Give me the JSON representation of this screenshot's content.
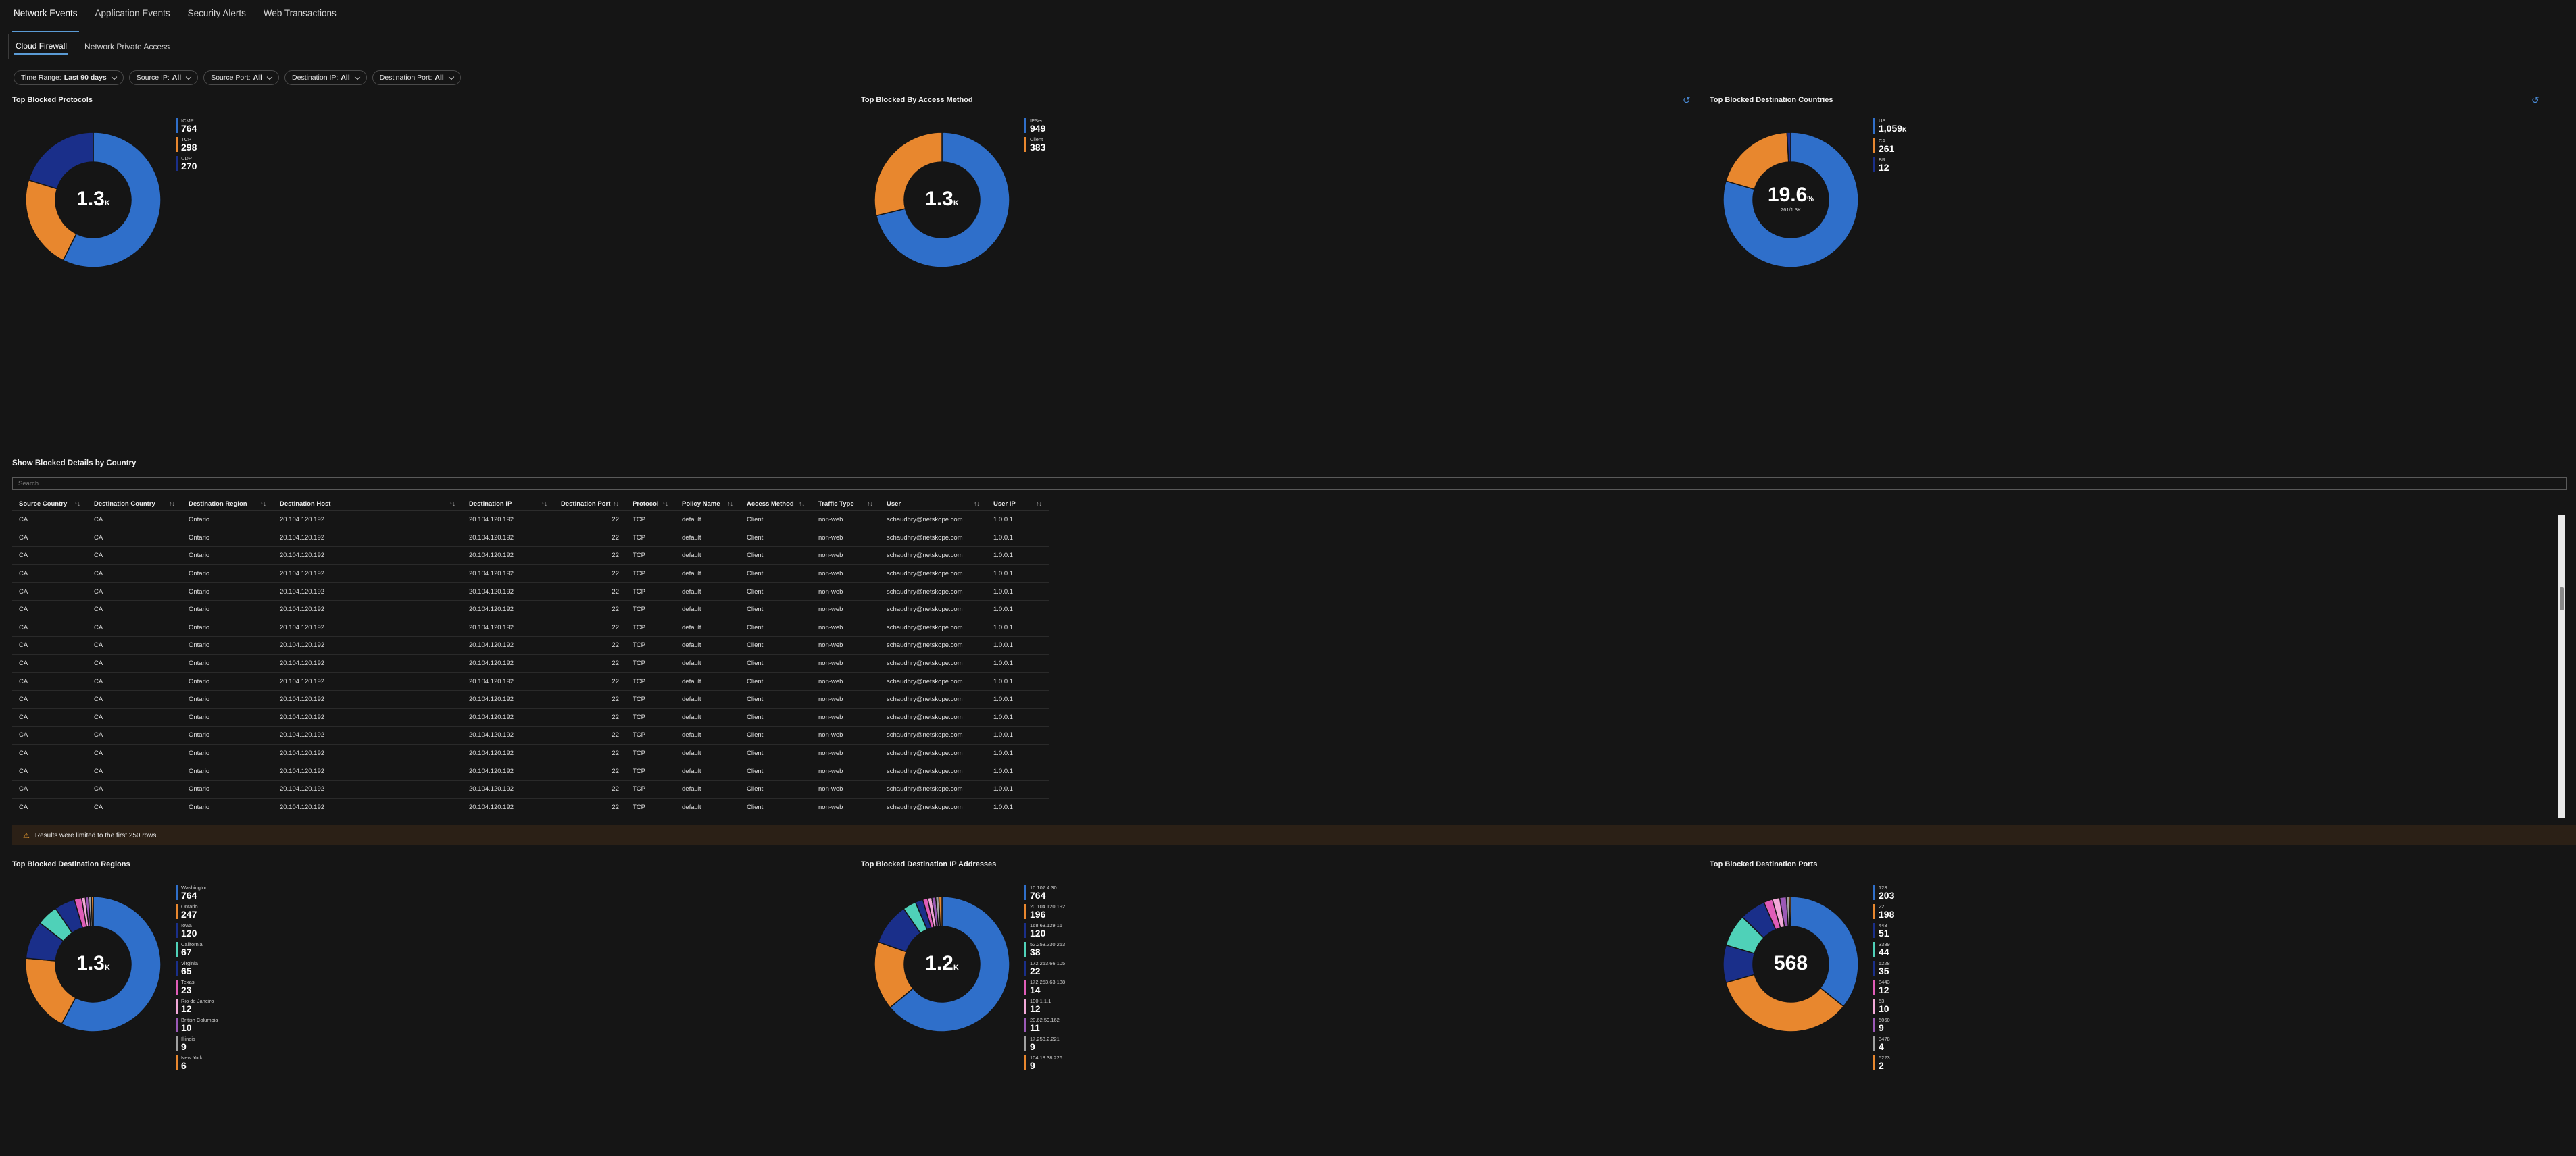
{
  "top_tabs": [
    "Network Events",
    "Application Events",
    "Security Alerts",
    "Web Transactions"
  ],
  "sub_tabs": [
    "Cloud Firewall",
    "Network Private Access"
  ],
  "filters": [
    {
      "label": "Time Range:",
      "value": "Last 90 days"
    },
    {
      "label": "Source IP:",
      "value": "All"
    },
    {
      "label": "Source Port:",
      "value": "All"
    },
    {
      "label": "Destination IP:",
      "value": "All"
    },
    {
      "label": "Destination Port:",
      "value": "All"
    }
  ],
  "panels": {
    "protocols": {
      "title": "Top Blocked Protocols",
      "center": "1.3",
      "center_unit": "K",
      "items": [
        {
          "label": "ICMP",
          "value": "764",
          "color": "#2f6fca"
        },
        {
          "label": "TCP",
          "value": "298",
          "color": "#e8872e"
        },
        {
          "label": "UDP",
          "value": "270",
          "color": "#1a2f8a"
        }
      ]
    },
    "access_method": {
      "title": "Top Blocked By Access Method",
      "center": "1.3",
      "center_unit": "K",
      "items": [
        {
          "label": "IPSec",
          "value": "949",
          "color": "#2f6fca"
        },
        {
          "label": "Client",
          "value": "383",
          "color": "#e8872e"
        }
      ]
    },
    "countries": {
      "title": "Top Blocked Destination Countries",
      "center": "19.6",
      "center_unit": "%",
      "center_sub": "261/1.3K",
      "items": [
        {
          "label": "US",
          "value": "1,059",
          "unit": "K",
          "color": "#2f6fca"
        },
        {
          "label": "CA",
          "value": "261",
          "color": "#e8872e"
        },
        {
          "label": "BR",
          "value": "12",
          "color": "#1a2f8a"
        }
      ]
    },
    "regions": {
      "title": "Top Blocked Destination Regions",
      "center": "1.3",
      "center_unit": "K",
      "items": [
        {
          "label": "Washington",
          "value": "764",
          "color": "#2f6fca"
        },
        {
          "label": "Ontario",
          "value": "247",
          "color": "#e8872e"
        },
        {
          "label": "Iowa",
          "value": "120",
          "color": "#1a2f8a"
        },
        {
          "label": "California",
          "value": "67",
          "color": "#4fd1b8"
        },
        {
          "label": "Virginia",
          "value": "65",
          "color": "#1a2f8a"
        },
        {
          "label": "Texas",
          "value": "23",
          "color": "#e05cb8"
        },
        {
          "label": "Rio de Janeiro",
          "value": "12",
          "color": "#f2a8d8"
        },
        {
          "label": "British Columbia",
          "value": "10",
          "color": "#9b59b6"
        },
        {
          "label": "Illinois",
          "value": "9",
          "color": "#a0a0a0"
        },
        {
          "label": "New York",
          "value": "6",
          "color": "#e8872e"
        }
      ]
    },
    "dest_ips": {
      "title": "Top Blocked Destination IP Addresses",
      "center": "1.2",
      "center_unit": "K",
      "items": [
        {
          "label": "10.107.4.30",
          "value": "764",
          "color": "#2f6fca"
        },
        {
          "label": "20.104.120.192",
          "value": "196",
          "color": "#e8872e"
        },
        {
          "label": "168.63.129.16",
          "value": "120",
          "color": "#1a2f8a"
        },
        {
          "label": "52.253.230.253",
          "value": "38",
          "color": "#4fd1b8"
        },
        {
          "label": "172.253.66.105",
          "value": "22",
          "color": "#1a2f8a"
        },
        {
          "label": "172.253.63.188",
          "value": "14",
          "color": "#e05cb8"
        },
        {
          "label": "100.1.1.1",
          "value": "12",
          "color": "#f2a8d8"
        },
        {
          "label": "20.62.59.162",
          "value": "11",
          "color": "#9b59b6"
        },
        {
          "label": "17.253.2.221",
          "value": "9",
          "color": "#a0a0a0"
        },
        {
          "label": "104.18.38.226",
          "value": "9",
          "color": "#e8872e"
        }
      ]
    },
    "ports": {
      "title": "Top Blocked Destination Ports",
      "center": "568",
      "center_unit": "",
      "items": [
        {
          "label": "123",
          "value": "203",
          "color": "#2f6fca"
        },
        {
          "label": "22",
          "value": "198",
          "color": "#e8872e"
        },
        {
          "label": "443",
          "value": "51",
          "color": "#1a2f8a"
        },
        {
          "label": "3389",
          "value": "44",
          "color": "#4fd1b8"
        },
        {
          "label": "5228",
          "value": "35",
          "color": "#1a2f8a"
        },
        {
          "label": "8443",
          "value": "12",
          "color": "#e05cb8"
        },
        {
          "label": "53",
          "value": "10",
          "color": "#f2a8d8"
        },
        {
          "label": "5060",
          "value": "9",
          "color": "#9b59b6"
        },
        {
          "label": "3478",
          "value": "4",
          "color": "#a0a0a0"
        },
        {
          "label": "5223",
          "value": "2",
          "color": "#e8872e"
        }
      ]
    }
  },
  "table": {
    "section_title": "Show Blocked Details by Country",
    "search_placeholder": "Search",
    "columns": [
      "Source Country",
      "Destination Country",
      "Destination Region",
      "Destination Host",
      "Destination IP",
      "Destination Port",
      "Protocol",
      "Policy Name",
      "Access Method",
      "Traffic Type",
      "User",
      "User IP"
    ],
    "row": [
      "CA",
      "CA",
      "Ontario",
      "20.104.120.192",
      "20.104.120.192",
      "22",
      "TCP",
      "default",
      "Client",
      "non-web",
      "schaudhry@netskope.com",
      "1.0.0.1"
    ],
    "row_count": 17,
    "warning": "Results were limited to the first 250 rows."
  }
}
